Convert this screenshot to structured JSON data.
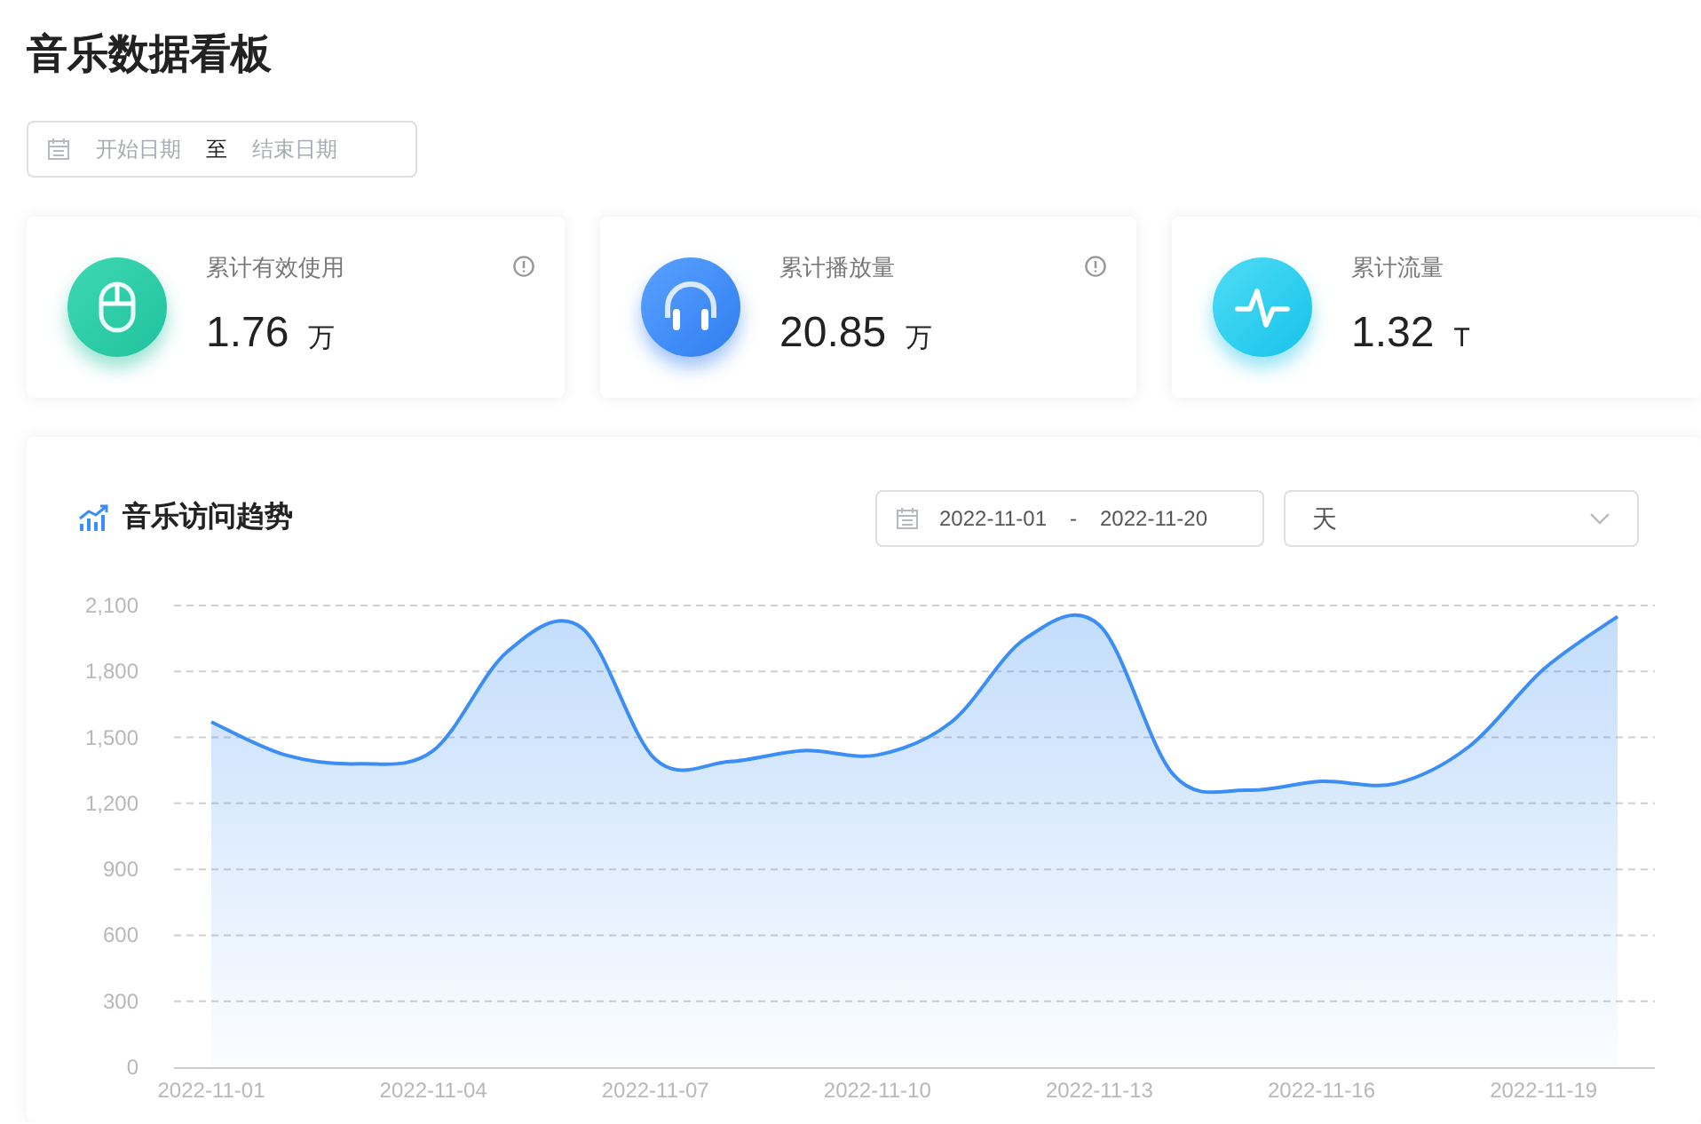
{
  "title": "音乐数据看板",
  "date_range": {
    "start_placeholder": "开始日期",
    "separator": "至",
    "end_placeholder": "结束日期"
  },
  "stats": [
    {
      "kind": "mouse",
      "label": "累计有效使用",
      "value": "1.76",
      "unit": "万",
      "info": true
    },
    {
      "kind": "headphones",
      "label": "累计播放量",
      "value": "20.85",
      "unit": "万",
      "info": true
    },
    {
      "kind": "pulse",
      "label": "累计流量",
      "value": "1.32",
      "unit": "T",
      "info": false
    }
  ],
  "trend": {
    "title": "音乐访问趋势",
    "date_range": {
      "start": "2022-11-01",
      "separator": "-",
      "end": "2022-11-20"
    },
    "granularity": "天",
    "chart_data": {
      "type": "area",
      "grid": true,
      "categories": [
        "2022-11-01",
        null,
        null,
        "2022-11-04",
        null,
        null,
        "2022-11-07",
        null,
        null,
        "2022-11-10",
        null,
        null,
        "2022-11-13",
        null,
        null,
        "2022-11-16",
        null,
        null,
        "2022-11-19",
        null
      ],
      "series": [
        {
          "color": "#3a8ef6",
          "values": [
            1570,
            1420,
            1380,
            1440,
            1890,
            2000,
            1400,
            1390,
            1440,
            1420,
            1570,
            1950,
            2010,
            1330,
            1260,
            1300,
            1290,
            1460,
            1810,
            2050
          ]
        }
      ],
      "ylim": [
        0,
        2100
      ],
      "yticks": [
        {
          "value": 0,
          "label": "0"
        },
        {
          "value": 300,
          "label": "300"
        },
        {
          "value": 600,
          "label": "600"
        },
        {
          "value": 900,
          "label": "900"
        },
        {
          "value": 1200,
          "label": "1,200"
        },
        {
          "value": 1500,
          "label": "1,500"
        },
        {
          "value": 1800,
          "label": "1,800"
        },
        {
          "value": 2100,
          "label": "2,100"
        }
      ]
    }
  }
}
